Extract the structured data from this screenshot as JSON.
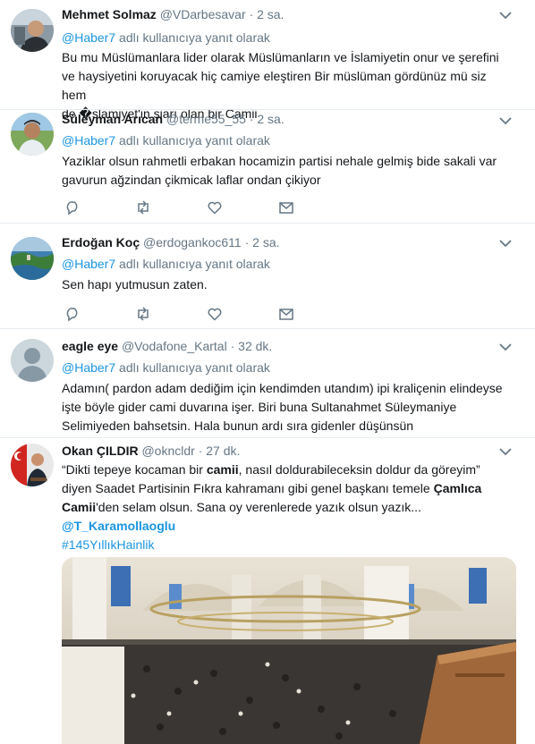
{
  "reply_prefix": "@Haber7",
  "reply_suffix": " adlı kullanıcıya yanıt olarak",
  "tweets": [
    {
      "name": "Mehmet Solmaz",
      "handle": "@VDarbesavar",
      "dot": "·",
      "time": "2 sa.",
      "lines": [
        "Bu mu Müslümanlara lider olarak Müslümanların ve İslamiyetin onur ve şerefini",
        "ve haysiyetini koruyacak hiç camiye eleştiren Bir müslüman gördünüz mü siz hem",
        "de �slamiyet'in şiarı olan bir Camii"
      ]
    },
    {
      "name": "Süleyman Arıcan",
      "handle": "@terme55_55",
      "dot": "·",
      "time": "2 sa.",
      "lines": [
        "Yaziklar olsun rahmetli erbakan hocamizin partisi nehale gelmiş bide sakali var",
        "gavurun ağzindan çikmicak laflar ondan çikiyor"
      ]
    },
    {
      "name": "Erdoğan Koç",
      "handle": "@erdogankoc611",
      "dot": "·",
      "time": "2 sa.",
      "lines": [
        "Sen hapı yutmusun  zaten."
      ]
    },
    {
      "name": "eagle eye",
      "handle": "@Vodafone_Kartal",
      "dot": "·",
      "time": "32 dk.",
      "lines": [
        "Adamın( pardon adam dediğim için kendimden utandım) ipi kraliçenin elindeyse",
        "işte böyle gider cami duvarına işer. Biri buna Sultanahmet Süleymaniye",
        "Selimiyeden bahsetsin. Hala bunun ardı sıra gidenler düşünsün"
      ]
    },
    {
      "name": "Okan ÇILDIR",
      "handle": "@okncldr",
      "dot": "·",
      "time": "27 dk.",
      "l1a": "“Dikti tepeye kocaman bir ",
      "l1b": "camii",
      "l1c": ", nasıl doldurabileceksin doldur da göreyim”",
      "l2a": "diyen Saadet Partisinin Fıkra kahramanı gibi genel başkanı temele ",
      "l2b": "Çamlıca",
      "l3a": "Camii",
      "l3b": "'den selam olsun. Sana oy verenlerede yazık olsun yazık...",
      "mention": "@T_Karamollaoglu",
      "hashtag": "#145YıllıkHainlik"
    }
  ],
  "colors": {
    "link": "#1b95e0",
    "muted": "#657786",
    "text": "#14171a",
    "separator": "#e6ecf0"
  },
  "icons": [
    "chevron-down-icon",
    "reply-icon",
    "retweet-icon",
    "like-icon",
    "message-icon"
  ]
}
